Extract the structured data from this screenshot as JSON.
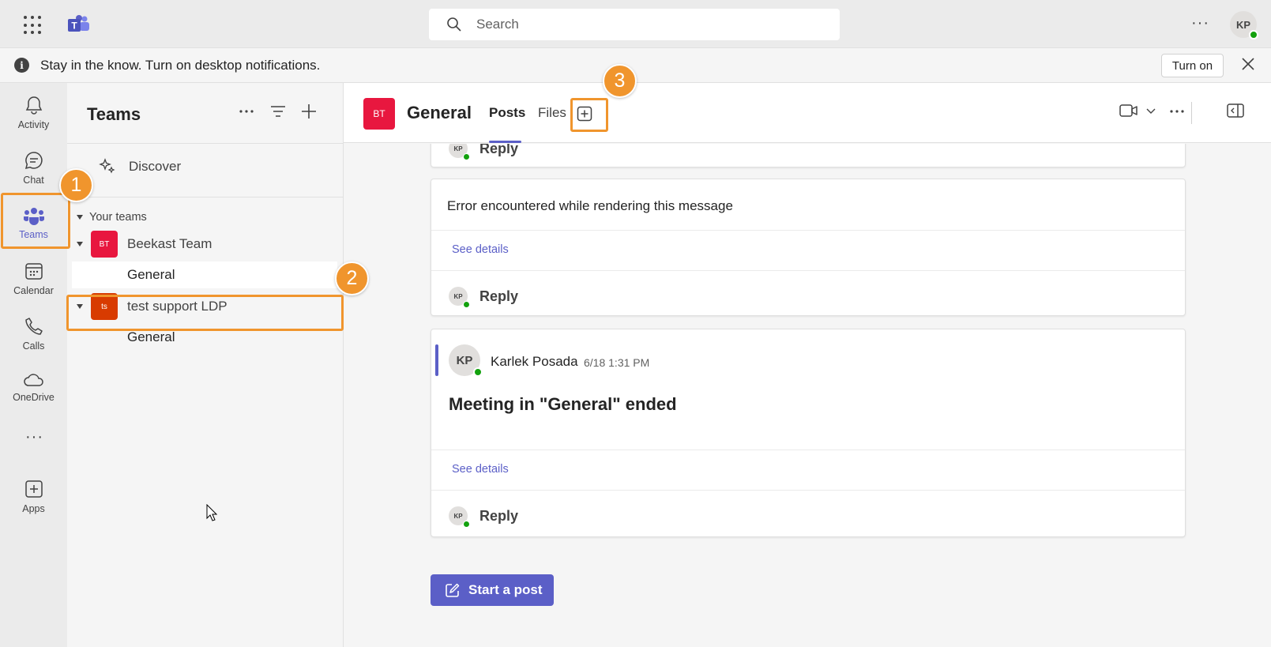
{
  "search": {
    "placeholder": "Search"
  },
  "user": {
    "initials": "KP"
  },
  "notification": {
    "text": "Stay in the know. Turn on desktop notifications.",
    "action_label": "Turn on"
  },
  "rail": {
    "items": [
      {
        "label": "Activity",
        "icon": "bell-icon"
      },
      {
        "label": "Chat",
        "icon": "chat-icon"
      },
      {
        "label": "Teams",
        "icon": "teams-icon",
        "active": true
      },
      {
        "label": "Calendar",
        "icon": "calendar-icon"
      },
      {
        "label": "Calls",
        "icon": "phone-icon"
      },
      {
        "label": "OneDrive",
        "icon": "cloud-icon"
      },
      {
        "label": "Apps",
        "icon": "apps-icon"
      }
    ]
  },
  "teams_panel": {
    "title": "Teams",
    "discover_label": "Discover",
    "section_label": "Your teams",
    "teams": [
      {
        "name": "Beekast Team",
        "initials": "BT",
        "color": "#e8173f",
        "channels": [
          "General"
        ]
      },
      {
        "name": "test support LDP",
        "initials": "ts",
        "color": "#d83b01",
        "channels": [
          "General"
        ]
      }
    ]
  },
  "channel": {
    "initials": "BT",
    "name": "General",
    "tabs": [
      "Posts",
      "Files"
    ],
    "active_tab": "Posts"
  },
  "feed": {
    "reply_label": "Reply",
    "see_details_label": "See details",
    "error_message": "Error encountered while rendering this message",
    "message": {
      "author": "Karlek Posada",
      "initials": "KP",
      "time": "6/18 1:31 PM",
      "title": "Meeting in \"General\" ended"
    },
    "start_post_label": "Start a post"
  },
  "annotations": {
    "step1": "1",
    "step2": "2",
    "step3": "3"
  },
  "colors": {
    "accent": "#5b5fc7",
    "highlight": "#f0952d",
    "presence": "#13a10e"
  }
}
